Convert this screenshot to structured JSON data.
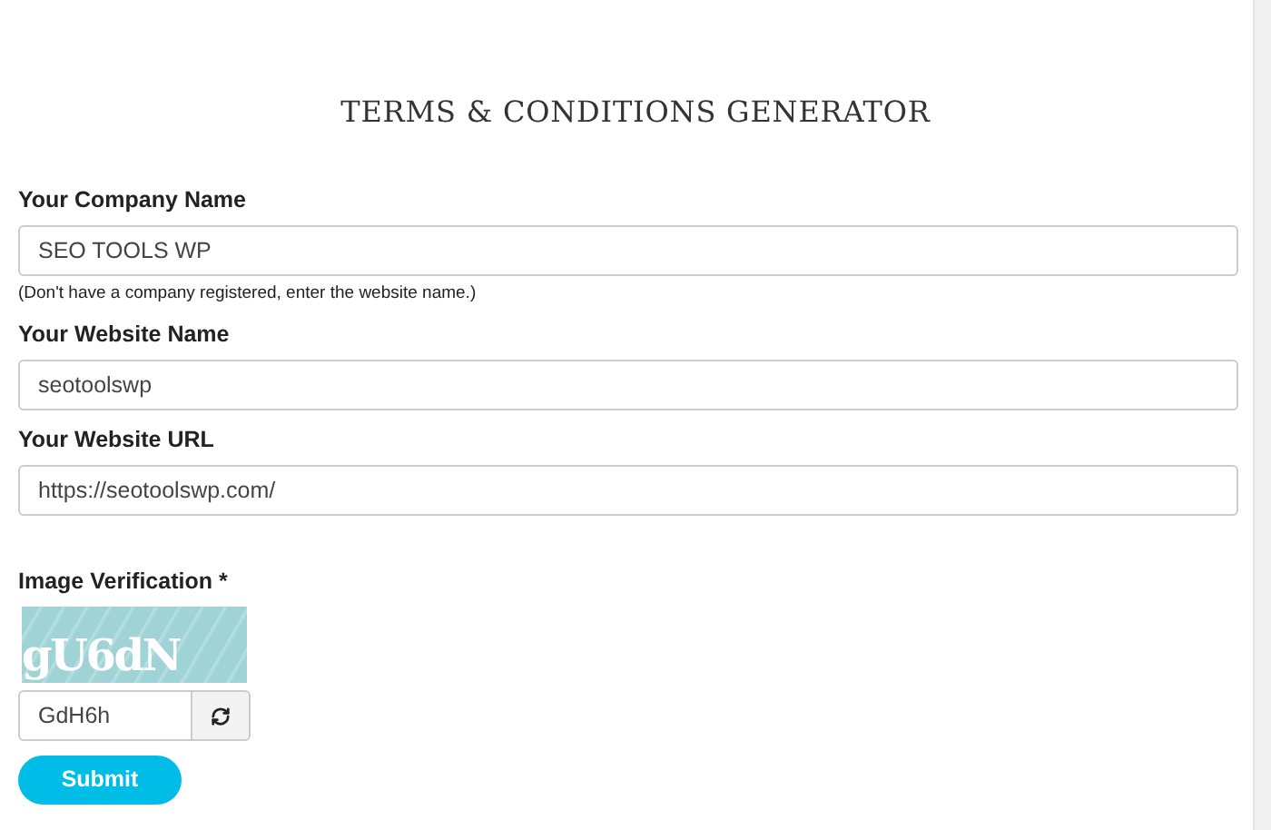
{
  "title": "TERMS & CONDITIONS GENERATOR",
  "fields": [
    {
      "label": "Your Company Name",
      "value": "SEO TOOLS WP",
      "hint": "(Don't have a company registered, enter the website name.)"
    },
    {
      "label": "Your Website Name",
      "value": "seotoolswp"
    },
    {
      "label": "Your Website URL",
      "value": "https://seotoolswp.com/"
    }
  ],
  "verification": {
    "label": "Image Verification *",
    "captcha_text": "gU6dN",
    "value": "GdH6h"
  },
  "submit": "Submit"
}
